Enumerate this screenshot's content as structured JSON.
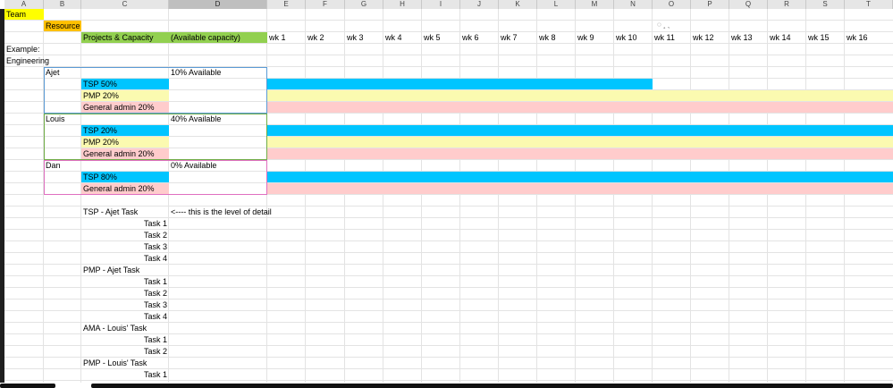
{
  "column_headers": [
    "A",
    "B",
    "C",
    "D",
    "E",
    "F",
    "G",
    "H",
    "I",
    "J",
    "K",
    "L",
    "M",
    "N",
    "O",
    "P",
    "Q",
    "R",
    "S",
    "T"
  ],
  "header": {
    "team": "Team",
    "resource": "Resource",
    "projects_capacity": "Projects & Capacity",
    "available_capacity": "(Available capacity)",
    "weeks": [
      "wk 1",
      "wk 2",
      "wk 3",
      "wk 4",
      "wk 5",
      "wk 6",
      "wk 7",
      "wk 8",
      "wk 9",
      "wk 10",
      "wk 11",
      "wk 12",
      "wk 13",
      "wk 14",
      "wk 15",
      "wk 16",
      "wk"
    ]
  },
  "labels": {
    "example": "Example:",
    "engineering": "Engineering"
  },
  "resources": [
    {
      "name": "Ajet",
      "available": "10% Available",
      "projects": [
        {
          "label": "TSP 50%",
          "color": "#00c5ff",
          "weeks_filled": 10
        },
        {
          "label": "PMP 20%",
          "color": "#fbfab0",
          "weeks_filled": 16
        },
        {
          "label": "General admin 20%",
          "color": "#ffcccc",
          "weeks_filled": 16
        }
      ]
    },
    {
      "name": "Louis",
      "available": "40% Available",
      "projects": [
        {
          "label": "TSP 20%",
          "color": "#00c5ff",
          "weeks_filled": 16
        },
        {
          "label": "PMP 20%",
          "color": "#fbfab0",
          "weeks_filled": 16
        },
        {
          "label": "General admin 20%",
          "color": "#ffcccc",
          "weeks_filled": 16
        }
      ]
    },
    {
      "name": "Dan",
      "available": "0% Available",
      "projects": [
        {
          "label": "TSP 80%",
          "color": "#00c5ff",
          "weeks_filled": 16
        },
        {
          "label": "General admin 20%",
          "color": "#ffcccc",
          "weeks_filled": 16
        }
      ]
    }
  ],
  "detail": {
    "note": "<---- this is the level of detail",
    "groups": [
      {
        "title": "TSP - Ajet Task",
        "tasks": [
          "Task 1",
          "Task 2",
          "Task 3",
          "Task 4"
        ]
      },
      {
        "title": "PMP - Ajet Task",
        "tasks": [
          "Task 1",
          "Task 2",
          "Task 3",
          "Task 4"
        ]
      },
      {
        "title": "AMA - Louis' Task",
        "tasks": [
          "Task 1",
          "Task 2"
        ]
      },
      {
        "title": "PMP - Louis' Task",
        "tasks": [
          "Task 1"
        ]
      }
    ]
  },
  "colors": {
    "team_fill": "#ffff00",
    "resource_fill": "#ffc000",
    "header_fill": "#92d050",
    "ajet_border": "#5b9bd5",
    "louis_border": "#70ad47",
    "dan_border": "#e070c0"
  }
}
